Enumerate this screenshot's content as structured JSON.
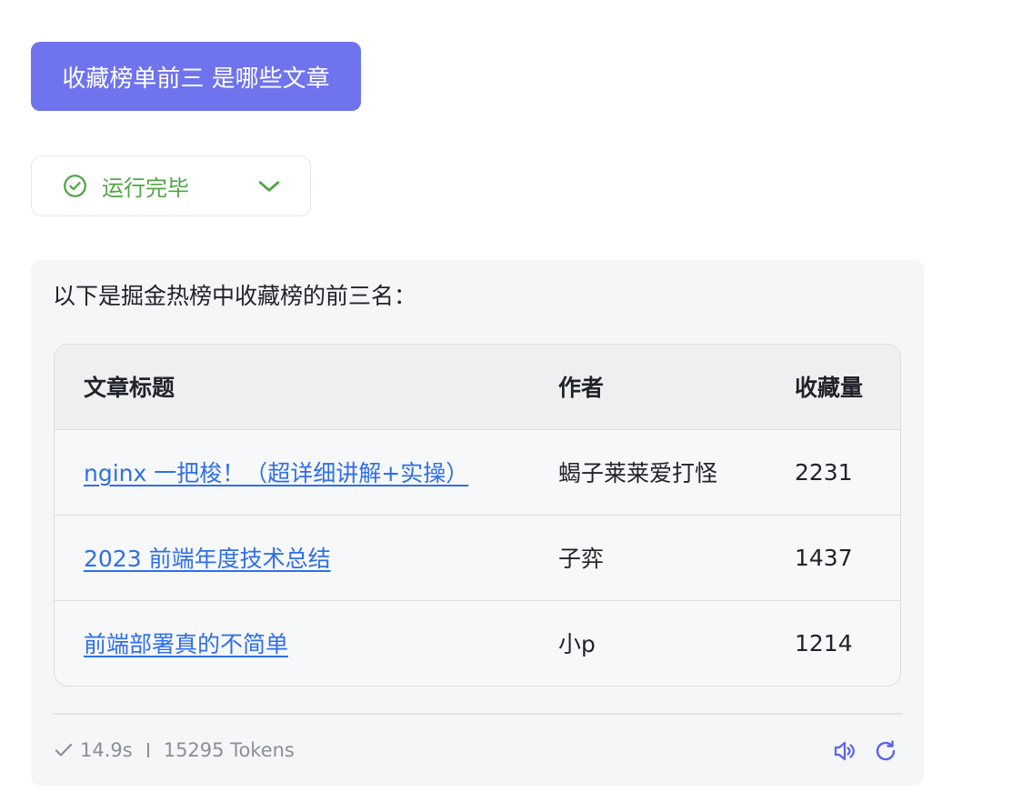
{
  "user_message": "收藏榜单前三 是哪些文章",
  "status": {
    "label": "运行完毕",
    "icon": "check-circle-icon",
    "color": "#52a447"
  },
  "answer": {
    "intro": "以下是掘金热榜中收藏榜的前三名：",
    "table": {
      "headers": [
        "文章标题",
        "作者",
        "收藏量"
      ],
      "rows": [
        {
          "title": "nginx 一把梭！（超详细讲解+实操）",
          "author": "蝎子莱莱爱打怪",
          "count": "2231"
        },
        {
          "title": "2023 前端年度技术总结",
          "author": "子弈",
          "count": "1437"
        },
        {
          "title": "前端部署真的不简单",
          "author": "小p",
          "count": "1214"
        }
      ]
    },
    "meta": {
      "duration": "14.9s",
      "tokens": "15295 Tokens"
    }
  },
  "colors": {
    "accent": "#6f73ee",
    "link": "#2f6fe8",
    "success": "#52a447",
    "icon_action": "#5b63e8"
  }
}
